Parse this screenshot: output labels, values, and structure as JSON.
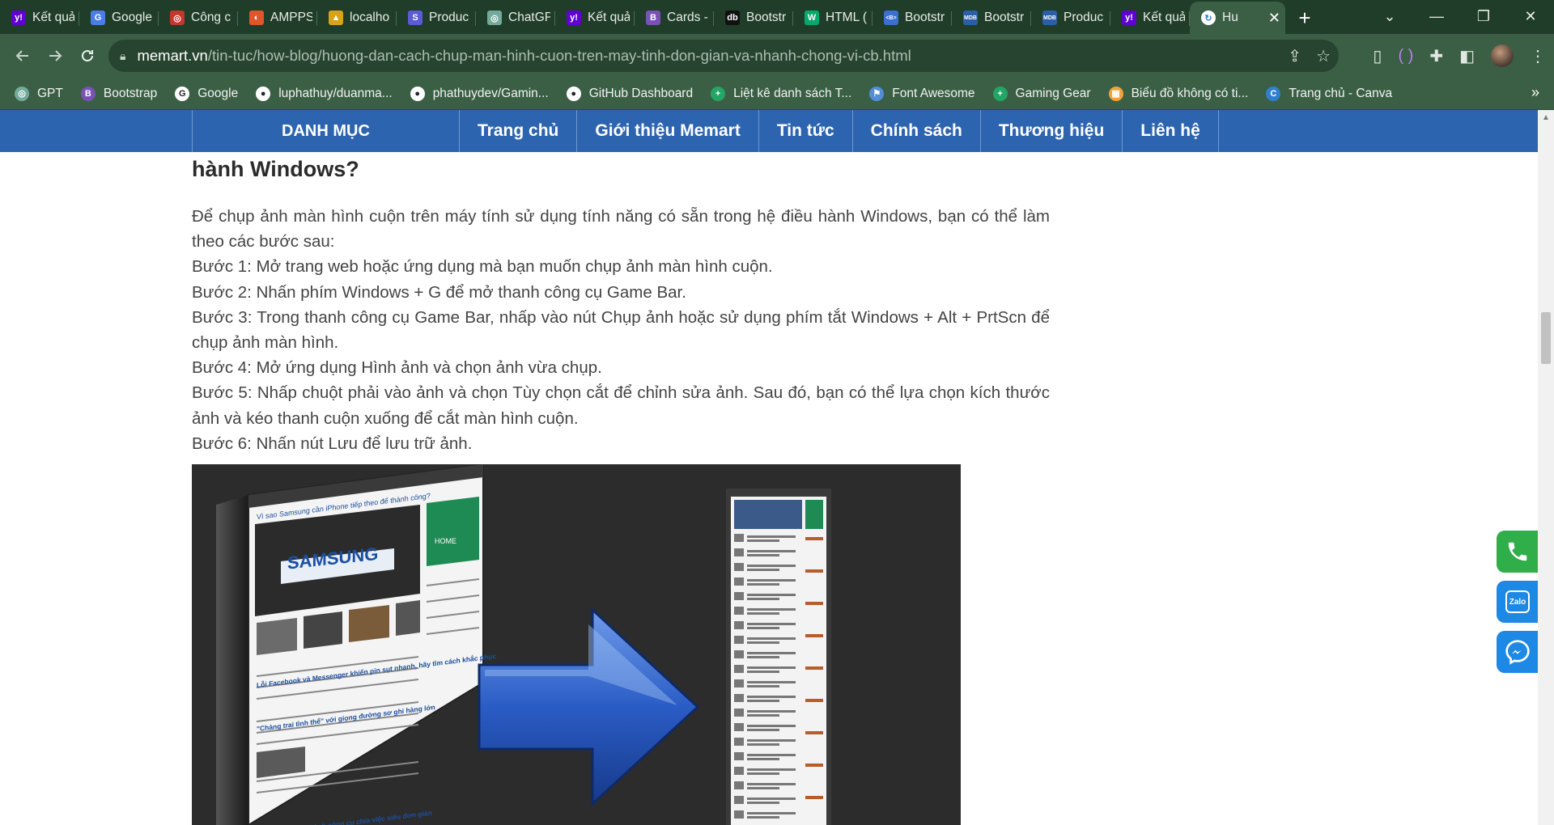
{
  "browser": {
    "tabs": [
      {
        "label": "Kết quả",
        "icon": "yahoo-icon",
        "color": "#6001d2",
        "glyph": "y!"
      },
      {
        "label": "Google",
        "icon": "google-translate-icon",
        "color": "#4a7ee6",
        "glyph": "G"
      },
      {
        "label": "Công c",
        "icon": "tool-icon",
        "color": "#c0392b",
        "glyph": "◎"
      },
      {
        "label": "AMPPS",
        "icon": "ampps-icon",
        "color": "#e0562a",
        "glyph": "◐"
      },
      {
        "label": "localho",
        "icon": "localhost-icon",
        "color": "#d9a21b",
        "glyph": "▲"
      },
      {
        "label": "Produc",
        "icon": "product-icon",
        "color": "#5b5bd6",
        "glyph": "S"
      },
      {
        "label": "ChatGP",
        "icon": "chatgpt-icon",
        "color": "#74aa9c",
        "glyph": "◎"
      },
      {
        "label": "Kết quả",
        "icon": "yahoo-icon",
        "color": "#6001d2",
        "glyph": "y!"
      },
      {
        "label": "Cards -",
        "icon": "bootstrap-icon",
        "color": "#7952b3",
        "glyph": "B"
      },
      {
        "label": "Bootstr",
        "icon": "dev-icon",
        "color": "#111111",
        "glyph": "db"
      },
      {
        "label": "HTML (",
        "icon": "w3-icon",
        "color": "#04aa6d",
        "glyph": "W"
      },
      {
        "label": "Bootstr",
        "icon": "bootstrap-studio-icon",
        "color": "#3b6fd1",
        "glyph": "<B>"
      },
      {
        "label": "Bootstr",
        "icon": "mdb-icon",
        "color": "#2a5fa8",
        "glyph": "MDB"
      },
      {
        "label": "Produc",
        "icon": "mdb-icon",
        "color": "#2a5fa8",
        "glyph": "MDB"
      },
      {
        "label": "Kết quả",
        "icon": "yahoo-icon",
        "color": "#6001d2",
        "glyph": "y!"
      }
    ],
    "active_tab": {
      "label": "Hu",
      "icon": "memart-icon",
      "color": "#2f7fd1",
      "glyph": "C"
    },
    "new_tab": "+",
    "url_host": "memart.vn",
    "url_path": "/tin-tuc/how-blog/huong-dan-cach-chup-man-hinh-cuon-tren-may-tinh-don-gian-va-nhanh-chong-vi-cb.html",
    "bookmarks": [
      {
        "label": "GPT",
        "icon": "chatgpt-icon",
        "color": "#74aa9c",
        "glyph": "◎"
      },
      {
        "label": "Bootstrap",
        "icon": "bootstrap-icon",
        "color": "#7952b3",
        "glyph": "B"
      },
      {
        "label": "Google",
        "icon": "google-icon",
        "color": "#ffffff",
        "glyph": "G"
      },
      {
        "label": "luphathuy/duanma...",
        "icon": "github-icon",
        "color": "#ffffff",
        "glyph": "●"
      },
      {
        "label": "phathuydev/Gamin...",
        "icon": "github-icon",
        "color": "#ffffff",
        "glyph": "●"
      },
      {
        "label": "GitHub Dashboard",
        "icon": "github-icon",
        "color": "#ffffff",
        "glyph": "●"
      },
      {
        "label": "Liệt kê danh sách T...",
        "icon": "sheets-icon",
        "color": "#23a566",
        "glyph": "+"
      },
      {
        "label": "Font Awesome",
        "icon": "flag-icon",
        "color": "#528dd7",
        "glyph": "⚑"
      },
      {
        "label": "Gaming Gear",
        "icon": "sheets-icon",
        "color": "#23a566",
        "glyph": "+"
      },
      {
        "label": "Biểu đồ không có ti...",
        "icon": "chart-icon",
        "color": "#f2a33a",
        "glyph": "▦"
      },
      {
        "label": "Trang chủ - Canva",
        "icon": "canva-icon",
        "color": "#2f7fd1",
        "glyph": "C"
      }
    ],
    "bookmarks_more": "»"
  },
  "site_nav": {
    "items": [
      "DANH MỤC",
      "Trang chủ",
      "Giới thiệu Memart",
      "Tin tức",
      "Chính sách",
      "Thương hiệu",
      "Liên hệ"
    ]
  },
  "article": {
    "heading": "hành Windows?",
    "intro": "Để chụp ảnh màn hình cuộn trên máy tính sử dụng tính năng có sẵn trong hệ điều hành Windows, bạn có thể làm theo các bước sau:",
    "steps": [
      "Bước 1: Mở trang web hoặc ứng dụng mà bạn muốn chụp ảnh màn hình cuộn.",
      "Bước 2: Nhấn phím Windows + G để mở thanh công cụ Game Bar.",
      "Bước 3: Trong thanh công cụ Game Bar, nhấp vào nút Chụp ảnh hoặc sử dụng phím tắt Windows + Alt + PrtScn để chụp ảnh màn hình.",
      "Bước 4: Mở ứng dụng Hình ảnh và chọn ảnh vừa chụp.",
      "Bước 5: Nhấp chuột phải vào ảnh và chọn Tùy chọn cắt để chỉnh sửa ảnh. Sau đó, bạn có thể lựa chọn kích thước ảnh và kéo thanh cuộn xuống để cắt màn hình cuộn.",
      "Bước 6: Nhấn nút Lưu để lưu trữ ảnh."
    ],
    "image_text": {
      "samsung_headline": "Vì sao Samsung cần iPhone tiếp theo để thành công?",
      "samsung_logo": "SAMSUNG",
      "facebook_headline": "Lỗi Facebook và Messenger khiến pin sụt nhanh, hãy tìm cách khắc phục",
      "quote_headline": "\"Chàng trai tình thể\" với giọng đường sơ ghi hàng lớn",
      "bottom_headline": "Biến Facebook thành công cụ chia việc siêu đơn giản",
      "home_label": "HOME"
    }
  },
  "floating": {
    "phone_color": "#2fae4a",
    "zalo_color": "#1e88e5",
    "messenger_color": "#1e88e5",
    "zalo_label": "Zalo"
  },
  "colors": {
    "nav_blue": "#2d64b0",
    "chrome_green": "#3b5f45"
  }
}
